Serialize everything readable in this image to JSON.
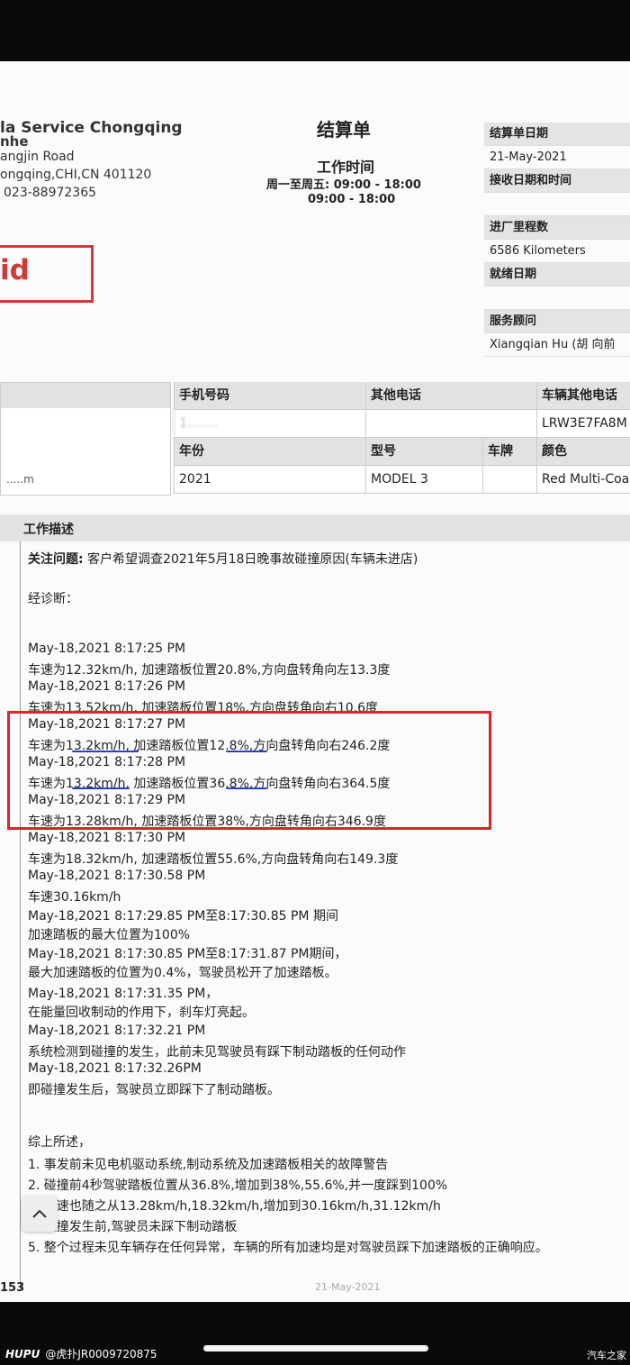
{
  "header": {
    "company": "la Service Chongqing",
    "company2": "nhe",
    "address1": "angjin Road",
    "address2": "ongqing,CHI,CN 401120",
    "phone": "023-88972365",
    "title": "结算单",
    "worktime_label": "工作时间",
    "hours_line1": "周一至周五: 09:00 - 18:00",
    "hours_line2": "09:00 - 18:00",
    "stamp": "id"
  },
  "side_table": [
    {
      "label": "结算单日期",
      "value": "21-May-2021"
    },
    {
      "label": "接收日期和时间",
      "value": ""
    },
    {
      "label": "进厂里程数",
      "value": "6586 Kilometers"
    },
    {
      "label": "就绪日期",
      "value": ""
    },
    {
      "label": "服务顾问",
      "value": "Xiangqian Hu (胡 向前"
    }
  ],
  "vehicle": {
    "owner_partial": ".....m",
    "headers1": [
      "手机号码",
      "其他电话",
      "车辆其他电话"
    ],
    "phone_blurred": "1........",
    "vin": "LRW3E7FA8M",
    "headers2": [
      "年份",
      "型号",
      "车牌",
      "颜色"
    ],
    "year": "2021",
    "model": "MODEL 3",
    "plate": "",
    "color": "Red Multi-Coa"
  },
  "description": {
    "section_title": "工作描述",
    "concern_label": "关注问题:",
    "concern_text": " 客户希望调查2021年5月18日晚事故碰撞原因(车辆未进店)",
    "diagnosis_label": "经诊断：",
    "log": [
      "May-18,2021 8:17:25 PM",
      "车速为12.32km/h, 加速踏板位置20.8%,方向盘转角向左13.3度",
      "May-18,2021 8:17:26 PM",
      "车速为13.52km/h, 加速踏板位置18%,方向盘转角向右10.6度",
      "May-18,2021 8:17:27 PM",
      "车速为13.2km/h, 加速踏板位置12.8%,方向盘转角向右246.2度",
      "May-18,2021 8:17:28 PM",
      "车速为13.2km/h, 加速踏板位置36.8%,方向盘转角向右364.5度",
      "May-18,2021 8:17:29 PM",
      "车速为13.28km/h, 加速踏板位置38%,方向盘转角向右346.9度",
      "May-18,2021 8:17:30 PM",
      "车速为18.32km/h, 加速踏板位置55.6%,方向盘转角向右149.3度",
      "May-18,2021 8:17:30.58 PM",
      "车速30.16km/h",
      "May-18,2021 8:17:29.85 PM至8:17:30.85 PM 期间",
      "加速踏板的最大位置为100%",
      "May-18,2021 8:17:30.85 PM至8:17:31.87 PM期间，",
      "最大加速踏板的位置为0.4%，驾驶员松开了加速踏板。",
      "May-18,2021 8:17:31.35 PM，",
      "在能量回收制动的作用下，刹车灯亮起。",
      "May-18,2021 8:17:32.21 PM",
      "系统检测到碰撞的发生，此前未见驾驶员有踩下制动踏板的任何动作",
      "May-18,2021 8:17:32.26PM",
      "即碰撞发生后，驾驶员立即踩下了制动踏板。"
    ],
    "summary_label": "综上所述，",
    "summary": [
      "1. 事发前未见电机驱动系统,制动系统及加速踏板相关的故障警告",
      "2. 碰撞前4秒驾驶踏板位置从36.8%,增加到38%,55.6%,并一度踩到100%",
      "3. 车速也随之从13.28km/h,18.32km/h,增加到30.16km/h,31.12km/h",
      "4. 碰撞发生前,驾驶员未踩下制动踏板",
      "5. 整个过程未见车辆存在任何异常，车辆的所有加速均是对驾驶员踩下加速踏板的正确响应。"
    ]
  },
  "footer": {
    "page_num": "153",
    "date": "21-May-2021"
  },
  "watermark": {
    "brand": "HUPU",
    "user": "@虎扑JR0009720875",
    "site": "汽车之家"
  }
}
